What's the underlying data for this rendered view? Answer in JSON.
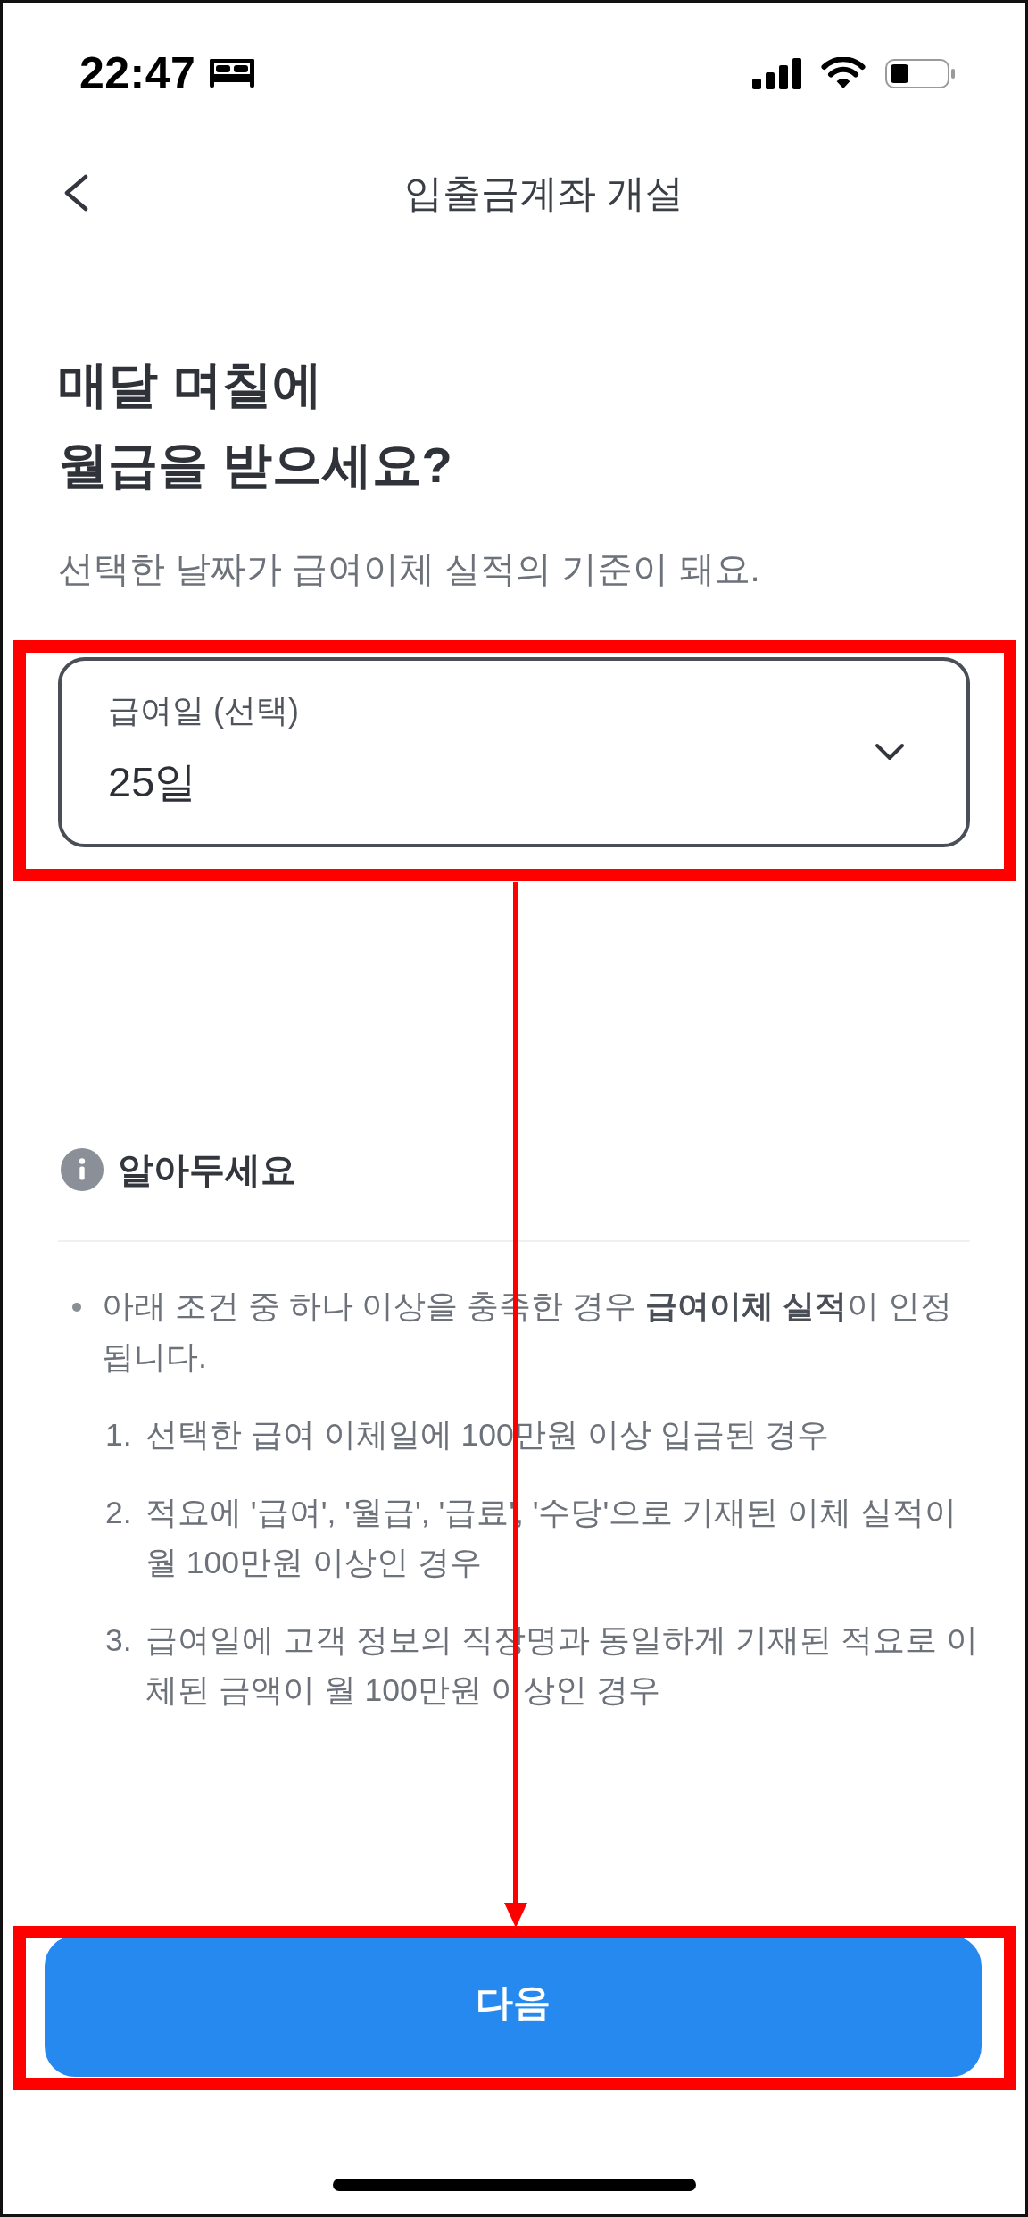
{
  "status_bar": {
    "time": "22:47"
  },
  "header": {
    "title": "입출금계좌 개설"
  },
  "heading": "매달 며칠에\n월급을 받으세요?",
  "subtitle": "선택한 날짜가 급여이체 실적의 기준이 돼요.",
  "payday_select": {
    "label": "급여일 (선택)",
    "value": "25일",
    "highlighted": true
  },
  "notice": {
    "title": "알아두세요",
    "bullet": "아래 조건 중 하나 이상을 충족한 경우 **급여이체 실적**이 인정됩니다.",
    "conditions": [
      {
        "number": "1.",
        "text": "선택한 급여 이체일에 100만원 이상 입금된 경우"
      },
      {
        "number": "2.",
        "text": "적요에 '급여', '월급', '급료', '수당'으로 기재된 이체 실적이 월 100만원 이상인 경우"
      },
      {
        "number": "3.",
        "text": "급여일에 고객 정보의 직장명과 동일하게 기재된 적요로 이체된 금액이 월 100만원 이상인 경우"
      }
    ]
  },
  "next_button": {
    "label": "다음",
    "highlighted": true
  },
  "annotation_arrow": true
}
